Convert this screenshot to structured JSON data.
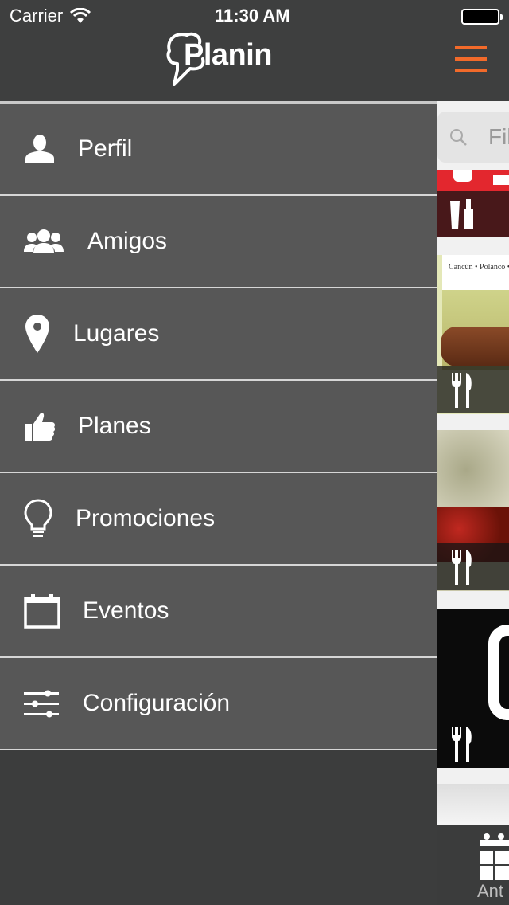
{
  "status_bar": {
    "carrier": "Carrier",
    "time": "11:30 AM"
  },
  "brand": {
    "logo_text": "Planin"
  },
  "menu": {
    "items": [
      {
        "label": "Perfil",
        "icon": "person-icon"
      },
      {
        "label": "Amigos",
        "icon": "friends-icon"
      },
      {
        "label": "Lugares",
        "icon": "location-pin-icon"
      },
      {
        "label": "Planes",
        "icon": "thumbs-up-icon"
      },
      {
        "label": "Promociones",
        "icon": "lightbulb-icon"
      },
      {
        "label": "Eventos",
        "icon": "calendar-icon"
      },
      {
        "label": "Configuración",
        "icon": "sliders-icon"
      }
    ]
  },
  "peek": {
    "search_placeholder": "Fil",
    "card_text": "Cancún • Polanco •",
    "tab_label": "Ant",
    "accent_color": "#f26a2a"
  }
}
